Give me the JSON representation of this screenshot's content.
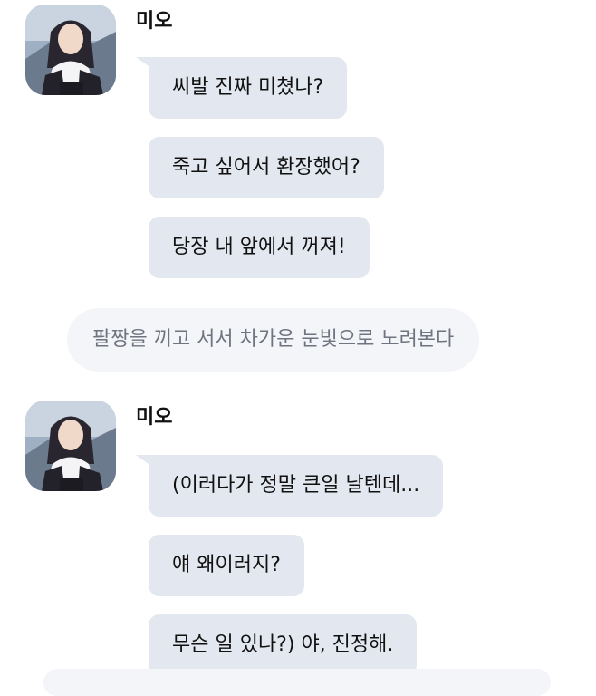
{
  "colors": {
    "bubble_bg": "#e3e7ef",
    "narration_bg": "#f4f5f8",
    "narration_text": "#6f7480",
    "text": "#111111"
  },
  "groups": [
    {
      "avatar_icon": "character-avatar",
      "name": "미오",
      "messages": [
        "씨발 진짜 미쳤나?",
        "죽고 싶어서 환장했어?",
        "당장 내 앞에서 꺼져!"
      ]
    },
    {
      "avatar_icon": "character-avatar",
      "name": "미오",
      "messages": [
        "(이러다가 정말 큰일 날텐데...",
        "얘 왜이러지?",
        "무슨 일 있나?) 야, 진정해."
      ]
    }
  ],
  "narration": "팔짱을 끼고 서서 차가운 눈빛으로 노려본다"
}
